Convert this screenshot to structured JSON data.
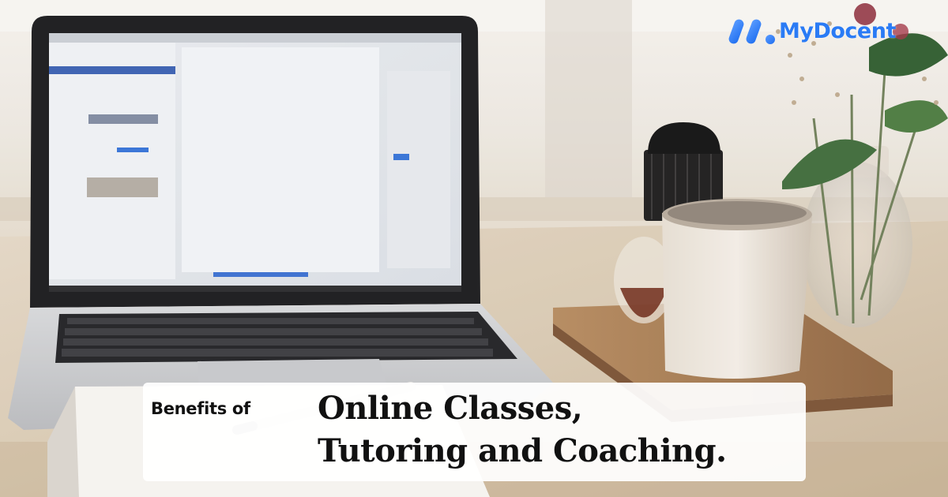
{
  "brand": {
    "logo_text": "MyDocent",
    "accent_color": "#2a7bf5"
  },
  "caption": {
    "prefix": "Benefits of",
    "line1": "Online Classes,",
    "line2": "Tutoring and Coaching."
  }
}
